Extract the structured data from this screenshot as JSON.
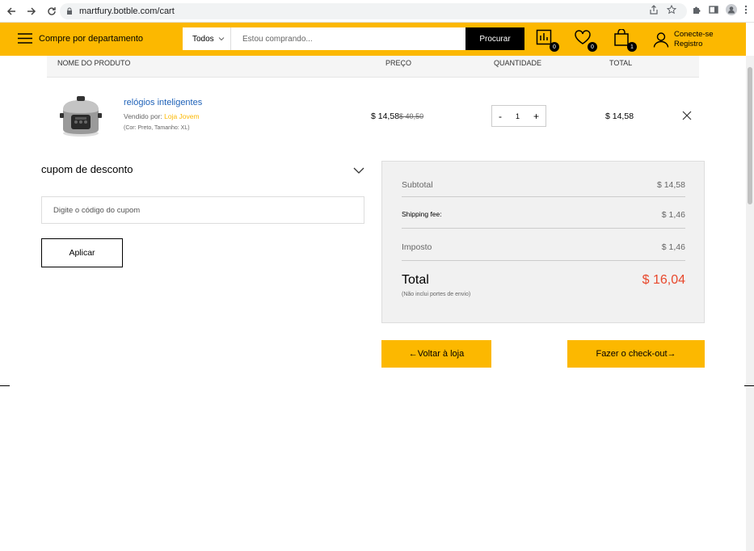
{
  "browser": {
    "url": "martfury.botble.com/cart"
  },
  "header": {
    "department_label": "Compre por departamento",
    "search_category": "Todos",
    "search_placeholder": "Estou comprando...",
    "search_button": "Procurar",
    "compare_count": "0",
    "wishlist_count": "0",
    "cart_count": "1",
    "login_label": "Conecte-se",
    "register_label": "Registro",
    "accent_color": "#fcb800"
  },
  "table": {
    "headers": [
      "NOME DO PRODUTO",
      "PREÇO",
      "QUANTIDADE",
      "TOTAL"
    ],
    "rows": [
      {
        "name": "relógios inteligentes",
        "vendor_prefix": "Vendido por:",
        "vendor": "Loja Jovem",
        "options": "(Cor: Preto, Tamanho: XL)",
        "price": "$ 14,58",
        "old_price": "$ 40,50",
        "qty_minus": "-",
        "qty": "1",
        "qty_plus": "+",
        "total": "$ 14,58"
      }
    ]
  },
  "coupon": {
    "title": "cupom de desconto",
    "placeholder": "Digite o código do cupom",
    "apply_label": "Aplicar"
  },
  "summary": {
    "subtotal_label": "Subtotal",
    "subtotal_value": "$ 14,58",
    "shipping_label": "Shipping fee:",
    "shipping_value": "$ 1,46",
    "tax_label": "Imposto",
    "tax_value": "$ 1,46",
    "total_label": "Total",
    "total_value": "$ 16,04",
    "total_note": "(Não inclui portes de envio)",
    "total_color": "#e8472b"
  },
  "actions": {
    "back_label": "Voltar à loja",
    "checkout_label": "Fazer o check-out"
  }
}
